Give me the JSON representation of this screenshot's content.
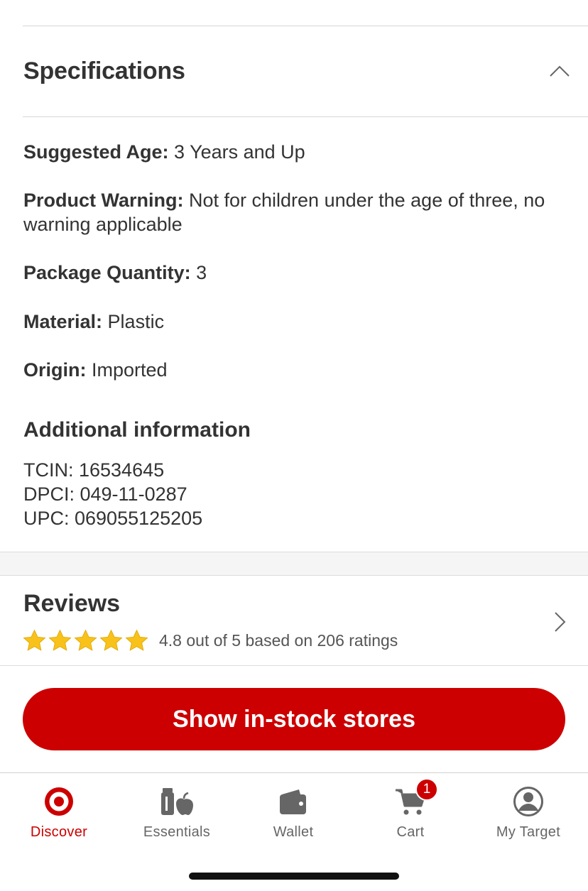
{
  "specifications": {
    "title": "Specifications",
    "rows": [
      {
        "key": "Suggested Age:",
        "value": " 3 Years and Up"
      },
      {
        "key": "Product Warning:",
        "value": " Not for children under the age of three, no warning applicable"
      },
      {
        "key": "Package Quantity:",
        "value": " 3"
      },
      {
        "key": "Material:",
        "value": " Plastic"
      },
      {
        "key": "Origin:",
        "value": " Imported"
      }
    ]
  },
  "additional_info": {
    "title": "Additional information",
    "tcin": "TCIN: 16534645",
    "dpci": "DPCI: 049-11-0287",
    "upc": "UPC: 069055125205"
  },
  "reviews": {
    "title": "Reviews",
    "rating": 4.8,
    "summary": "4.8 out of 5 based on 206 ratings"
  },
  "cta": {
    "label": "Show in-stock stores"
  },
  "tabbar": {
    "tabs": [
      {
        "label": "Discover",
        "icon": "target-logo-icon",
        "active": true
      },
      {
        "label": "Essentials",
        "icon": "essentials-icon"
      },
      {
        "label": "Wallet",
        "icon": "wallet-icon"
      },
      {
        "label": "Cart",
        "icon": "cart-icon"
      },
      {
        "label": "My Target",
        "icon": "user-circle-icon"
      }
    ],
    "cart_badge": "1"
  },
  "colors": {
    "brand_red": "#cc0000",
    "star_gold": "#f8c21b",
    "text": "#333333"
  }
}
